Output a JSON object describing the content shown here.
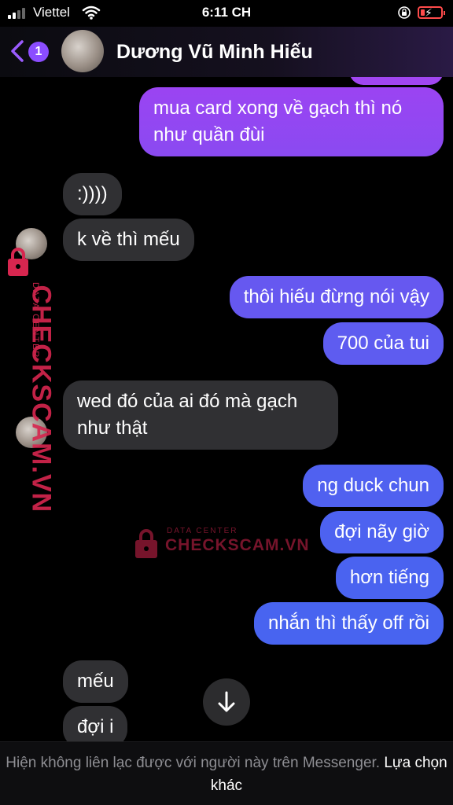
{
  "status_bar": {
    "carrier": "Viettel",
    "time": "6:11 CH",
    "icons": [
      "signal-icon",
      "wifi-icon",
      "orientation-lock-icon",
      "battery-charging-icon"
    ]
  },
  "header": {
    "unread_count": "1",
    "contact_name": "Dương Vũ Minh Hiếu",
    "back_icon": "chevron-left-icon"
  },
  "messages": [
    {
      "from": "me",
      "text": "mua card xong về gạch thì nó\nnhư quần đùi"
    },
    {
      "from": "them",
      "text": ":))))"
    },
    {
      "from": "them",
      "text": "k về thì mếu"
    },
    {
      "from": "me",
      "text": "thôi hiếu đừng nói vậy"
    },
    {
      "from": "me",
      "text": "700 của tui"
    },
    {
      "from": "them",
      "text": "wed đó của ai đó mà gạch\nnhư thật"
    },
    {
      "from": "me",
      "text": "ng duck chun"
    },
    {
      "from": "me",
      "text": "đợi nãy giờ"
    },
    {
      "from": "me",
      "text": "hơn tiếng"
    },
    {
      "from": "me",
      "text": "nhắn thì thấy off rồi"
    },
    {
      "from": "them",
      "text": "mếu"
    },
    {
      "from": "them",
      "text": "đợi i"
    }
  ],
  "watermark": {
    "brand": "CHECKSCAM.VN",
    "subtitle": "DATA CENTER"
  },
  "footer": {
    "notice": "Hiện không liên lạc được với người này trên Messenger.",
    "action": "Lựa chọn khác"
  },
  "colors": {
    "incoming_bubble": "#303033",
    "outgoing_top": "#9b44f2",
    "outgoing_bottom": "#4a63f0",
    "accent": "#8b4dff",
    "watermark": "#d7264f"
  }
}
